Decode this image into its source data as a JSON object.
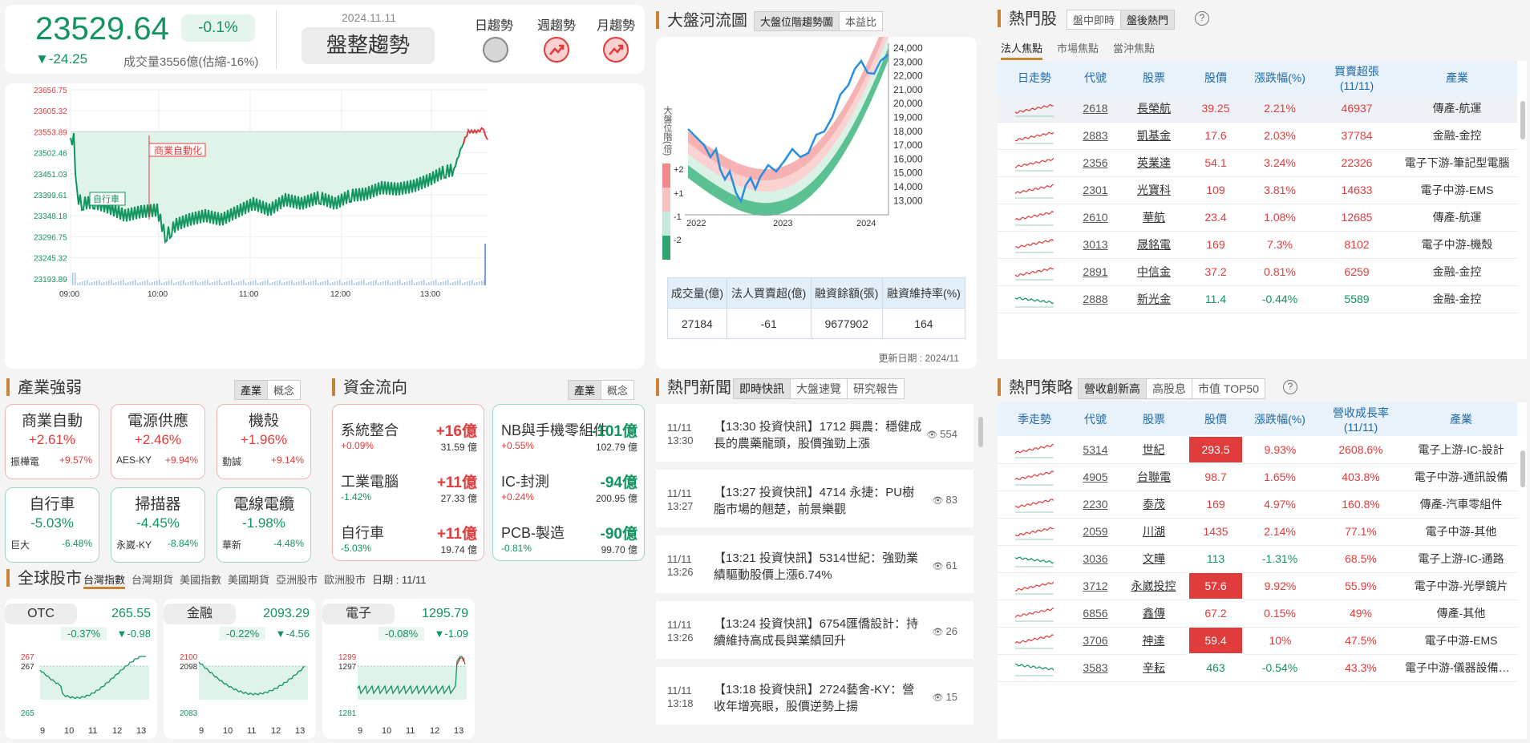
{
  "header": {
    "index_value": "23529.64",
    "pct_change": "-0.1%",
    "point_change": "▼-24.25",
    "volume": "成交量3556億(估縮-16%)",
    "date": "2024.11.11",
    "trend_label": "盤整趨勢",
    "trend_cols": [
      "日趨勢",
      "週趨勢",
      "月趨勢"
    ]
  },
  "intraday": {
    "y_ticks": [
      "23656.75",
      "23605.32",
      "23553.89",
      "23502.46",
      "23451.03",
      "23399.61",
      "23348.18",
      "23296.75",
      "23245.32",
      "23193.89"
    ],
    "x_ticks": [
      "09:00",
      "10:00",
      "11:00",
      "12:00",
      "13:00"
    ],
    "annotation1": "商業自動化",
    "annotation2": "自行車"
  },
  "river": {
    "title": "大盤河流圖",
    "tabs": [
      "大盤位階趨勢圖",
      "本益比"
    ],
    "ylabel": "大盤位階(倍)",
    "band_labels": [
      "+2",
      "+1",
      "-1",
      "-2"
    ],
    "y_ticks": [
      "24,000",
      "23,000",
      "22,000",
      "21,000",
      "20,000",
      "19,000",
      "18,000",
      "17,000",
      "16,000",
      "15,000",
      "14,000",
      "13,000"
    ],
    "x_ticks": [
      "2022",
      "2023",
      "2024"
    ],
    "table_headers": [
      "成交量(億)",
      "法人買賣超(億)",
      "融資餘額(張)",
      "融資維持率(%)"
    ],
    "table_values": [
      "27184",
      "-61",
      "9677902",
      "164"
    ],
    "updated": "更新日期 : 2024/11"
  },
  "hot": {
    "title": "熱門股",
    "tabs": [
      "盤中即時",
      "盤後熱門"
    ],
    "subtabs": [
      "法人焦點",
      "市場焦點",
      "當沖焦點"
    ],
    "headers": [
      "日走勢",
      "代號",
      "股票",
      "股價",
      "漲跌幅(%)",
      "買賣超張\n(11/11)",
      "產業"
    ],
    "rows": [
      {
        "code": "2618",
        "name": "長榮航",
        "price": "39.25",
        "chg": "2.21%",
        "vol": "46937",
        "ind": "傳產-航運",
        "up": true
      },
      {
        "code": "2883",
        "name": "凱基金",
        "price": "17.6",
        "chg": "2.03%",
        "vol": "37784",
        "ind": "金融-金控",
        "up": true
      },
      {
        "code": "2356",
        "name": "英業達",
        "price": "54.1",
        "chg": "3.24%",
        "vol": "22326",
        "ind": "電子下游-筆記型電腦",
        "up": true
      },
      {
        "code": "2301",
        "name": "光寶科",
        "price": "109",
        "chg": "3.81%",
        "vol": "14633",
        "ind": "電子中游-EMS",
        "up": true
      },
      {
        "code": "2610",
        "name": "華航",
        "price": "23.4",
        "chg": "1.08%",
        "vol": "12685",
        "ind": "傳產-航運",
        "up": true
      },
      {
        "code": "3013",
        "name": "晟銘電",
        "price": "169",
        "chg": "7.3%",
        "vol": "8102",
        "ind": "電子中游-機殼",
        "up": true
      },
      {
        "code": "2891",
        "name": "中信金",
        "price": "37.2",
        "chg": "0.81%",
        "vol": "6259",
        "ind": "金融-金控",
        "up": true
      },
      {
        "code": "2888",
        "name": "新光金",
        "price": "11.4",
        "chg": "-0.44%",
        "vol": "5589",
        "ind": "金融-金控",
        "up": false
      }
    ]
  },
  "industry": {
    "title": "產業強弱",
    "tabs": [
      "產業",
      "概念"
    ],
    "cards": [
      {
        "name": "商業自動",
        "pct": "+2.61%",
        "stock": "振樺電",
        "spct": "+9.57%",
        "up": true
      },
      {
        "name": "電源供應",
        "pct": "+2.46%",
        "stock": "AES-KY",
        "spct": "+9.94%",
        "up": true
      },
      {
        "name": "機殼",
        "pct": "+1.96%",
        "stock": "勤誠",
        "spct": "+9.14%",
        "up": true
      },
      {
        "name": "自行車",
        "pct": "-5.03%",
        "stock": "巨大",
        "spct": "-6.48%",
        "up": false
      },
      {
        "name": "掃描器",
        "pct": "-4.45%",
        "stock": "永崴-KY",
        "spct": "-8.84%",
        "up": false
      },
      {
        "name": "電線電纜",
        "pct": "-1.98%",
        "stock": "華新",
        "spct": "-4.48%",
        "up": false
      }
    ]
  },
  "flow": {
    "title": "資金流向",
    "tabs": [
      "產業",
      "概念"
    ],
    "inflow": [
      {
        "name": "系統整合",
        "amt": "+16億",
        "pct": "+0.09%",
        "val": "31.59 億"
      },
      {
        "name": "工業電腦",
        "amt": "+11億",
        "pct": "-1.42%",
        "val": "27.33 億"
      },
      {
        "name": "自行車",
        "amt": "+11億",
        "pct": "-5.03%",
        "val": "19.74 億"
      }
    ],
    "outflow": [
      {
        "name": "NB與手機零組件",
        "amt": "-101億",
        "pct": "+0.55%",
        "val": "102.79 億"
      },
      {
        "name": "IC-封測",
        "amt": "-94億",
        "pct": "+0.24%",
        "val": "200.95 億"
      },
      {
        "name": "PCB-製造",
        "amt": "-90億",
        "pct": "-0.81%",
        "val": "99.70 億"
      }
    ]
  },
  "news": {
    "title": "熱門新聞",
    "tabs": [
      "即時快訊",
      "大盤速覽",
      "研究報告"
    ],
    "items": [
      {
        "time": "11/11\n13:30",
        "text": "【13:30 投資快訊】1712 興農：穩健成長的農藥龍頭，股價強勁上漲",
        "views": "554"
      },
      {
        "time": "11/11\n13:27",
        "text": "【13:27 投資快訊】4714 永捷：PU樹脂市場的翹楚，前景樂觀",
        "views": "83"
      },
      {
        "time": "11/11\n13:26",
        "text": "【13:21 投資快訊】5314世紀：強勁業績驅動股價上漲6.74%",
        "views": "61"
      },
      {
        "time": "11/11\n13:26",
        "text": "【13:24 投資快訊】6754匯僑設計：持續維持高成長與業績回升",
        "views": "26"
      },
      {
        "time": "11/11\n13:18",
        "text": "【13:18 投資快訊】2724藝舍-KY：營收年增亮眼，股價逆勢上揚",
        "views": "15"
      }
    ]
  },
  "strategy": {
    "title": "熱門策略",
    "tabs": [
      "營收創新高",
      "高股息",
      "市值 TOP50"
    ],
    "headers": [
      "季走勢",
      "代號",
      "股票",
      "股價",
      "漲跌幅(%)",
      "營收成長率\n(11/11)",
      "產業"
    ],
    "rows": [
      {
        "code": "5314",
        "name": "世紀",
        "price": "293.5",
        "chg": "9.93%",
        "growth": "2608.6%",
        "ind": "電子上游-IC-設計",
        "up": true,
        "limit": true
      },
      {
        "code": "4905",
        "name": "台聯電",
        "price": "98.7",
        "chg": "1.65%",
        "growth": "403.8%",
        "ind": "電子中游-通訊設備",
        "up": true,
        "limit": false
      },
      {
        "code": "2230",
        "name": "泰茂",
        "price": "169",
        "chg": "4.97%",
        "growth": "160.8%",
        "ind": "傳產-汽車零組件",
        "up": true,
        "limit": false
      },
      {
        "code": "2059",
        "name": "川湖",
        "price": "1435",
        "chg": "2.14%",
        "growth": "77.1%",
        "ind": "電子中游-其他",
        "up": true,
        "limit": false
      },
      {
        "code": "3036",
        "name": "文曄",
        "price": "113",
        "chg": "-1.31%",
        "growth": "68.5%",
        "ind": "電子上游-IC-通路",
        "up": false,
        "limit": false
      },
      {
        "code": "3712",
        "name": "永崴投控",
        "price": "57.6",
        "chg": "9.92%",
        "growth": "55.9%",
        "ind": "電子中游-光學鏡片",
        "up": true,
        "limit": true
      },
      {
        "code": "6856",
        "name": "鑫傳",
        "price": "67.2",
        "chg": "0.15%",
        "growth": "49%",
        "ind": "傳產-其他",
        "up": true,
        "limit": false
      },
      {
        "code": "3706",
        "name": "神達",
        "price": "59.4",
        "chg": "10%",
        "growth": "47.5%",
        "ind": "電子中游-EMS",
        "up": true,
        "limit": true
      },
      {
        "code": "3583",
        "name": "辛耘",
        "price": "463",
        "chg": "-0.54%",
        "growth": "43.3%",
        "ind": "電子中游-儀器設備工...",
        "up": false,
        "limit": false
      }
    ]
  },
  "global": {
    "title": "全球股市",
    "tabs": [
      "台灣指數",
      "台灣期貨",
      "美國指數",
      "美國期貨",
      "亞洲股市",
      "歐洲股市"
    ],
    "date": "日期 : 11/11",
    "minis": [
      {
        "name": "OTC",
        "value": "265.55",
        "pct": "-0.37%",
        "chg": "▼-0.98",
        "hi": "267",
        "prev": "267",
        "lo": "265",
        "x": [
          "9",
          "10",
          "11",
          "12",
          "13"
        ]
      },
      {
        "name": "金融",
        "value": "2093.29",
        "pct": "-0.22%",
        "chg": "▼-4.56",
        "hi": "2100",
        "prev": "2098",
        "lo": "2083",
        "x": [
          "9",
          "10",
          "11",
          "12",
          "13"
        ]
      },
      {
        "name": "電子",
        "value": "1295.79",
        "pct": "-0.08%",
        "chg": "▼-1.09",
        "hi": "1299",
        "prev": "1297",
        "lo": "1281",
        "x": [
          "9",
          "10",
          "11",
          "12",
          "13"
        ]
      }
    ]
  },
  "colors": {
    "up": "#e03c3c",
    "down": "#12945e",
    "accent": "#c8823a"
  }
}
